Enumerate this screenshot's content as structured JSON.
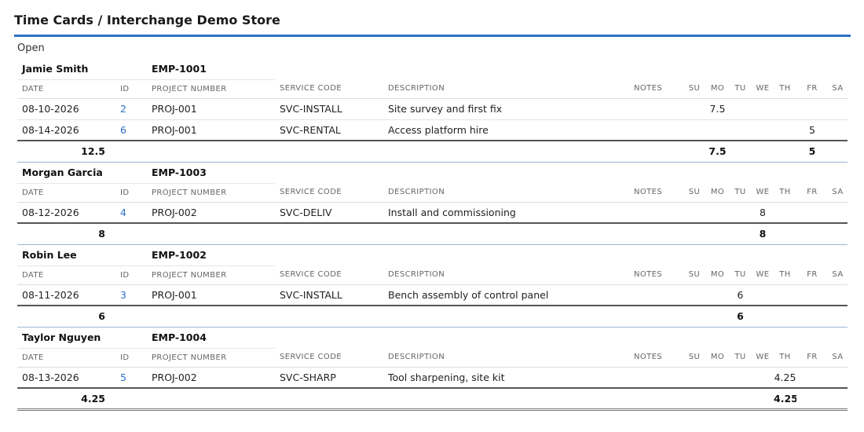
{
  "page": {
    "title": "Time Cards / Interchange Demo Store",
    "status": "Open",
    "accent": "#2d6fc9"
  },
  "columns": {
    "date": "DATE",
    "id": "ID",
    "project_number": "PROJECT NUMBER",
    "service_code": "SERVICE CODE",
    "description": "DESCRIPTION",
    "notes": "NOTES",
    "su": "SU",
    "mo": "MO",
    "tu": "TU",
    "we": "WE",
    "th": "TH",
    "fr": "FR",
    "sa": "SA"
  },
  "employees": [
    {
      "name": "Jamie Smith",
      "code": "EMP-1001",
      "entries": [
        {
          "date": "08-10-2026",
          "id": "2",
          "project": "PROJ-001",
          "service": "SVC-INSTALL",
          "description": "Site survey and first fix",
          "notes": "",
          "su": "",
          "mo": "7.5",
          "tu": "",
          "we": "",
          "th": "",
          "fr": "",
          "sa": ""
        },
        {
          "date": "08-14-2026",
          "id": "6",
          "project": "PROJ-001",
          "service": "SVC-RENTAL",
          "description": "Access platform hire",
          "notes": "",
          "su": "",
          "mo": "",
          "tu": "",
          "we": "",
          "th": "",
          "fr": "5",
          "sa": ""
        }
      ],
      "totals": {
        "total": "12.5",
        "su": "",
        "mo": "7.5",
        "tu": "",
        "we": "",
        "th": "",
        "fr": "5",
        "sa": ""
      }
    },
    {
      "name": "Morgan Garcia",
      "code": "EMP-1003",
      "entries": [
        {
          "date": "08-12-2026",
          "id": "4",
          "project": "PROJ-002",
          "service": "SVC-DELIV",
          "description": "Install and commissioning",
          "notes": "",
          "su": "",
          "mo": "",
          "tu": "",
          "we": "8",
          "th": "",
          "fr": "",
          "sa": ""
        }
      ],
      "totals": {
        "total": "8",
        "su": "",
        "mo": "",
        "tu": "",
        "we": "8",
        "th": "",
        "fr": "",
        "sa": ""
      }
    },
    {
      "name": "Robin Lee",
      "code": "EMP-1002",
      "entries": [
        {
          "date": "08-11-2026",
          "id": "3",
          "project": "PROJ-001",
          "service": "SVC-INSTALL",
          "description": "Bench assembly of control panel",
          "notes": "",
          "su": "",
          "mo": "",
          "tu": "6",
          "we": "",
          "th": "",
          "fr": "",
          "sa": ""
        }
      ],
      "totals": {
        "total": "6",
        "su": "",
        "mo": "",
        "tu": "6",
        "we": "",
        "th": "",
        "fr": "",
        "sa": ""
      }
    },
    {
      "name": "Taylor Nguyen",
      "code": "EMP-1004",
      "entries": [
        {
          "date": "08-13-2026",
          "id": "5",
          "project": "PROJ-002",
          "service": "SVC-SHARP",
          "description": "Tool sharpening, site kit",
          "notes": "",
          "su": "",
          "mo": "",
          "tu": "",
          "we": "",
          "th": "4.25",
          "fr": "",
          "sa": ""
        }
      ],
      "totals": {
        "total": "4.25",
        "su": "",
        "mo": "",
        "tu": "",
        "we": "",
        "th": "4.25",
        "fr": "",
        "sa": ""
      }
    }
  ]
}
